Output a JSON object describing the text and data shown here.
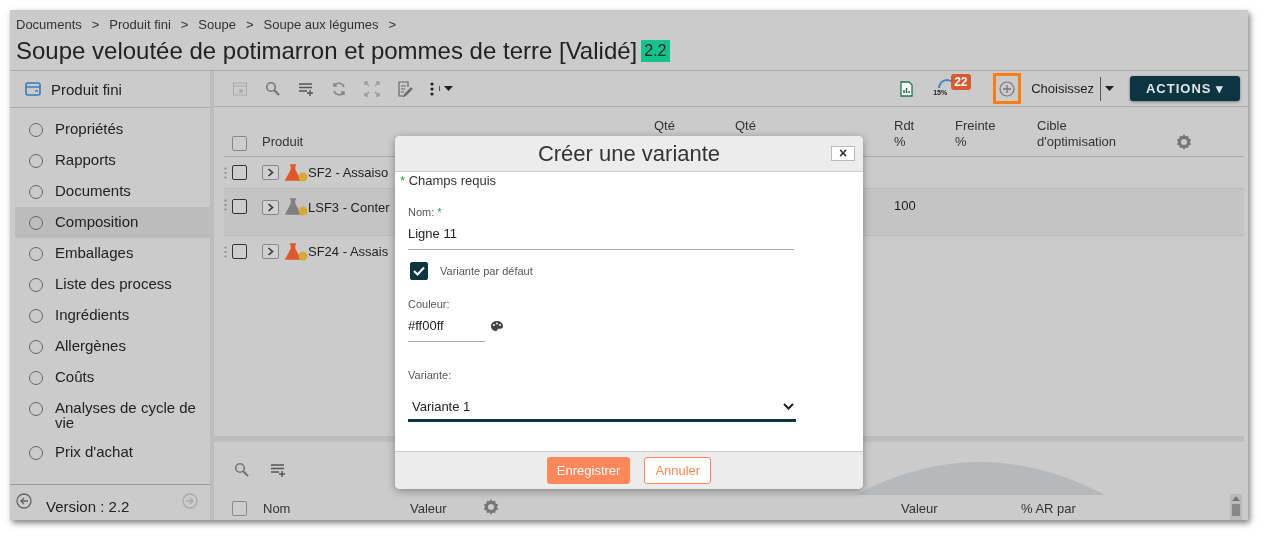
{
  "breadcrumb": [
    "Documents",
    "Produit fini",
    "Soupe",
    "Soupe aux légumes"
  ],
  "breadcrumb_separator": ">",
  "title": "Soupe veloutée de potimarron et pommes de terre [Validé]",
  "version_badge": "2.2",
  "sidebar": {
    "header": "Produit fini",
    "items": [
      {
        "label": "Propriétés",
        "selected": false
      },
      {
        "label": "Rapports",
        "selected": false
      },
      {
        "label": "Documents",
        "selected": false
      },
      {
        "label": "Composition",
        "selected": true
      },
      {
        "label": "Emballages",
        "selected": false
      },
      {
        "label": "Liste des process",
        "selected": false
      },
      {
        "label": "Ingrédients",
        "selected": false
      },
      {
        "label": "Allergènes",
        "selected": false
      },
      {
        "label": "Coûts",
        "selected": false
      },
      {
        "label": "Analyses de cycle de vie",
        "selected": false
      },
      {
        "label": "Prix d'achat",
        "selected": false
      }
    ],
    "version": "Version : 2.2"
  },
  "toolbar": {
    "gauge_reading": "15%",
    "badge": "22",
    "view_select": "Choisissez",
    "actions": "ACTIONS ▾"
  },
  "table": {
    "columns": [
      "Produit",
      "Qté",
      "Qté",
      "Rdt\n%",
      "Freinte\n%",
      "Cible\nd'optimisation"
    ],
    "rows": [
      {
        "product": "SF2 - Assaiso",
        "color": "#e0582a",
        "selected": false,
        "checked": false
      },
      {
        "product": "LSF3 - Conter",
        "color": "#808080",
        "selected": true,
        "checked": false,
        "rdt": "100"
      },
      {
        "product": "SF24 - Assais",
        "color": "#e0582a",
        "selected": false,
        "checked": false
      }
    ],
    "all_checked": false
  },
  "bottom_table": {
    "columns": [
      "Nom",
      "Valeur",
      "Valeur",
      "% AR par"
    ],
    "all_checked": false
  },
  "dialog": {
    "title": "Créer une variante",
    "required_note": "Champs requis",
    "required_mark": "*",
    "name_label": "Nom:",
    "name_value": "Ligne 11",
    "default_label": "Variante par défaut",
    "default_checked": true,
    "color_label": "Couleur:",
    "color_value": "#ff00ff",
    "variant_label": "Variante:",
    "variant_value": "Variante 1",
    "save": "Enregistrer",
    "cancel": "Annuler",
    "close": "×"
  }
}
